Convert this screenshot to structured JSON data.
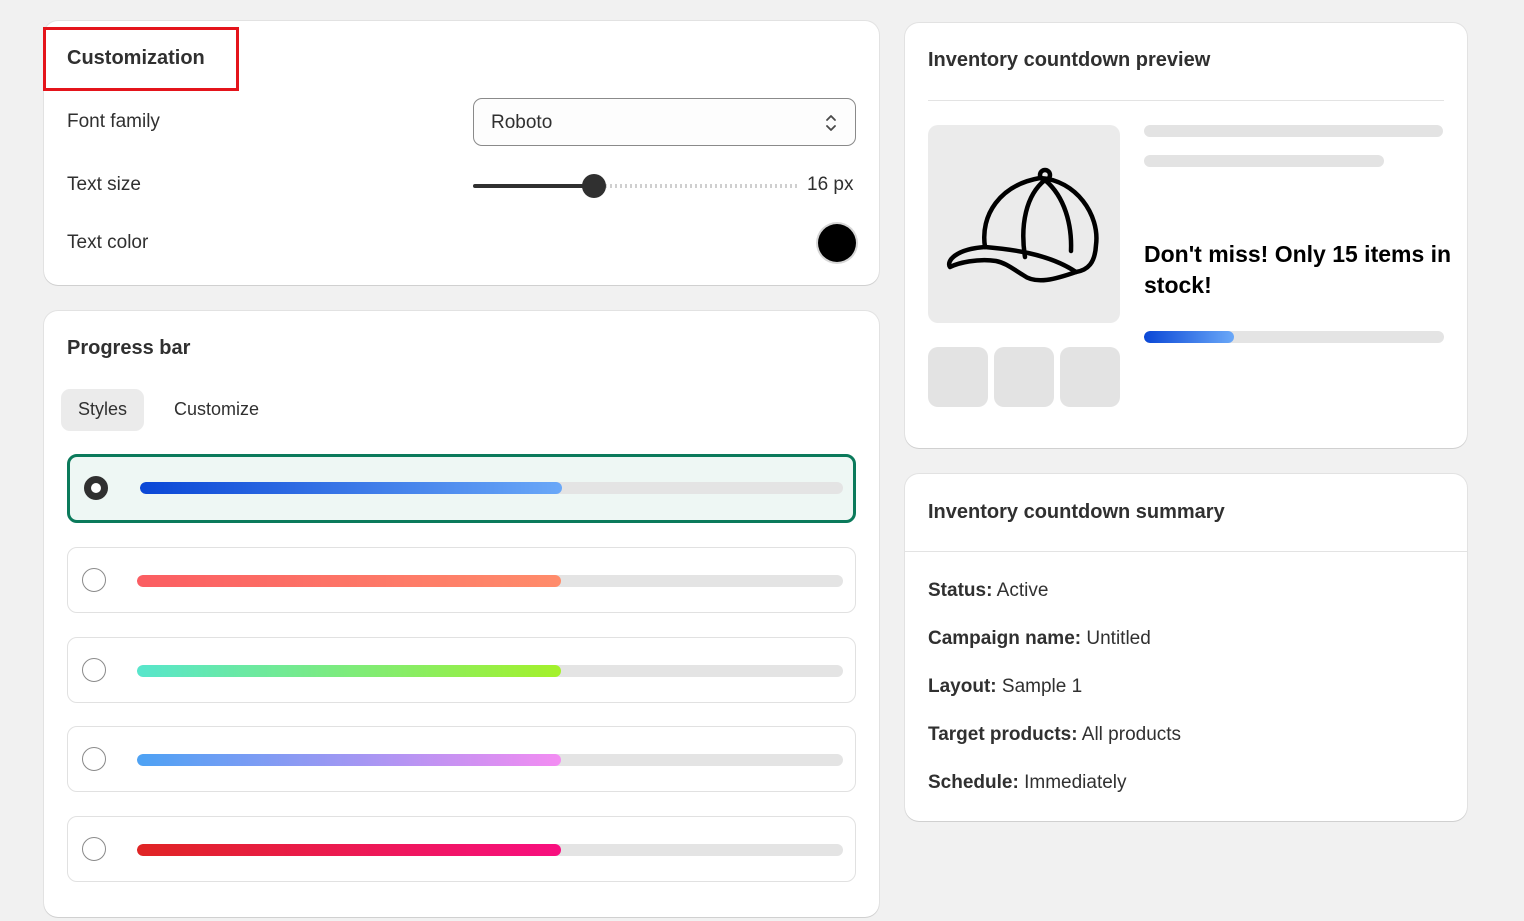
{
  "customization": {
    "title": "Customization",
    "font_family_label": "Font family",
    "font_family_value": "Roboto",
    "text_size_label": "Text size",
    "text_size_value": "16 px",
    "text_color_label": "Text color",
    "text_color_value": "#000000"
  },
  "progress_bar": {
    "title": "Progress bar",
    "tabs": [
      {
        "label": "Styles",
        "active": true
      },
      {
        "label": "Customize",
        "active": false
      }
    ],
    "styles": [
      {
        "selected": true,
        "fill_fraction": 0.6,
        "gradient": [
          "#0a47d6",
          "#6aa8f8"
        ]
      },
      {
        "selected": false,
        "fill_fraction": 0.6,
        "gradient": [
          "#fb5d62",
          "#ff8c6b"
        ]
      },
      {
        "selected": false,
        "fill_fraction": 0.6,
        "gradient": [
          "#57e6cc",
          "#a4f12a"
        ]
      },
      {
        "selected": false,
        "fill_fraction": 0.6,
        "gradient": [
          "#4da2f4",
          "#f38cf2"
        ]
      },
      {
        "selected": false,
        "fill_fraction": 0.6,
        "gradient": [
          "#e02424",
          "#f80f80"
        ]
      }
    ]
  },
  "preview": {
    "title": "Inventory countdown preview",
    "product_icon": "cap-icon",
    "message": "Don't miss! Only 15 items in stock!",
    "progress_fraction": 0.3,
    "progress_gradient": [
      "#0a47d6",
      "#6aa8f8"
    ]
  },
  "summary": {
    "title": "Inventory countdown summary",
    "rows": [
      {
        "key": "Status:",
        "value": "Active"
      },
      {
        "key": "Campaign name:",
        "value": "Untitled"
      },
      {
        "key": "Layout:",
        "value": "Sample 1"
      },
      {
        "key": "Target products:",
        "value": "All products"
      },
      {
        "key": "Schedule:",
        "value": "Immediately"
      }
    ]
  }
}
